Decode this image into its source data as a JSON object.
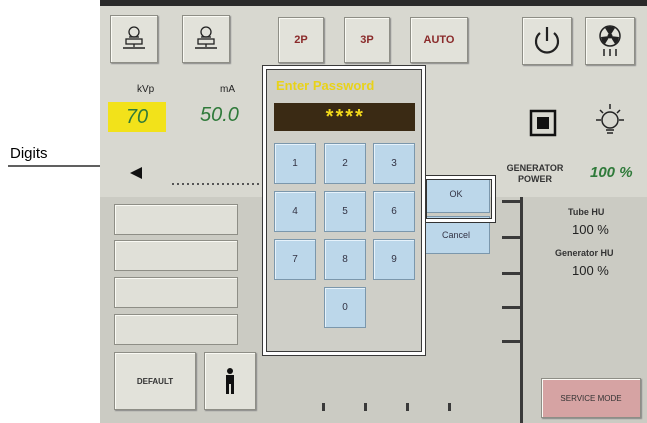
{
  "callout": {
    "label": "Digits"
  },
  "top_buttons": {
    "p2": "2P",
    "p3": "3P",
    "auto": "AUTO"
  },
  "kvp": {
    "label": "kVp",
    "value": "70"
  },
  "ma": {
    "label": "mA",
    "value": "50.0"
  },
  "password": {
    "title": "Enter Password",
    "masked": "****"
  },
  "keypad": {
    "keys": [
      "1",
      "2",
      "3",
      "4",
      "5",
      "6",
      "7",
      "8",
      "9",
      "0"
    ]
  },
  "dialog": {
    "ok": "OK",
    "cancel": "Cancel"
  },
  "generator": {
    "label_line1": "GENERATOR",
    "label_line2": "POWER",
    "value": "100 %"
  },
  "tube_hu": {
    "label": "Tube HU",
    "value": "100 %"
  },
  "generator_hu": {
    "label": "Generator HU",
    "value": "100 %"
  },
  "bottom": {
    "default": "DEFAULT",
    "service_mode": "SERVICE MODE"
  },
  "colors": {
    "screen_bg": "#d8d8d0",
    "kvp_highlight": "#f2e21a",
    "password_title": "#e8d21a",
    "key_fill": "#bcd7ea",
    "readout_green": "#2f7a3a"
  },
  "icons": [
    "bucky-icon",
    "bucky-icon",
    "power-icon",
    "radiation-icon",
    "collimator-icon",
    "lamp-icon",
    "person-icon",
    "left-arrow-icon"
  ]
}
